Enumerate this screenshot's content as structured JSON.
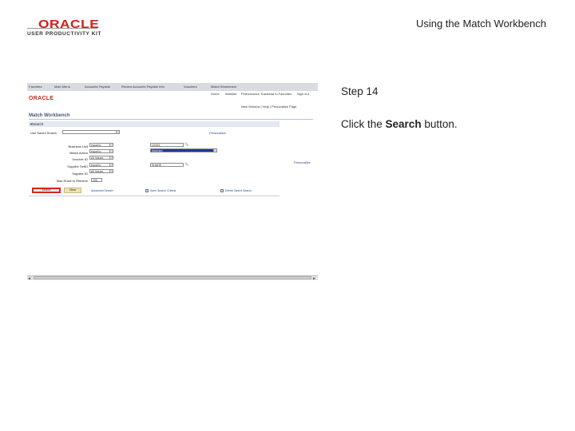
{
  "header": {
    "logo_brand": "ORACLE",
    "logo_product": "USER PRODUCTIVITY KIT",
    "slide_title": "Using the Match Workbench",
    "brand_color": "#d0211c"
  },
  "instruction": {
    "step": "Step 14",
    "prefix": "Click the ",
    "target": "Search",
    "suffix": " button."
  },
  "app": {
    "breadcrumbs": [
      "Favorites",
      "Main Menu",
      "Accounts Payable",
      "Review Accounts Payable Info",
      "Vouchers",
      "Match Workbench"
    ],
    "logo": "ORACLE",
    "top_links": [
      "Home",
      "Worklist",
      "Performance Trace",
      "Add to Favorites",
      "Sign out"
    ],
    "window_links": "New Window | Help | Personalize Page",
    "page_title": "Match Workbench",
    "section_title": "Search",
    "saved_search_label": "Use Saved Search",
    "personalize_label": "Personalize",
    "fields": [
      {
        "label": "Business Unit",
        "op": "equal to",
        "value": "US001"
      },
      {
        "label": "Match Action",
        "op": "equal to",
        "value": "Matched"
      },
      {
        "label": "Voucher ID",
        "op": "All Values",
        "value": ""
      },
      {
        "label": "Supplier SetID",
        "op": "equal to",
        "value": "SHARE"
      },
      {
        "label": "Supplier ID",
        "op": "All Values",
        "value": ""
      }
    ],
    "max_rows_label": "Max Rows to Retrieve",
    "max_rows_value": "200",
    "results_label": "Personalize",
    "search_button": "Search",
    "clear_button": "Clear",
    "advanced_search": "Advanced Search",
    "save_search": "Save Search Criteria",
    "delete_search": "Delete Saved Search"
  }
}
